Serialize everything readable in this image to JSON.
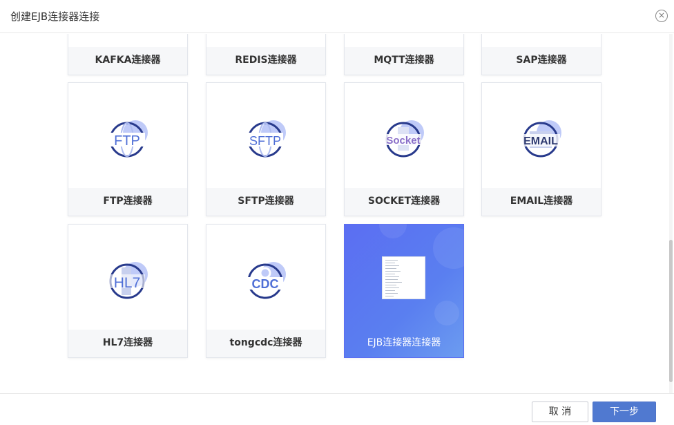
{
  "dialog": {
    "title": "创建EJB连接器连接",
    "close_icon": "close-circle-icon"
  },
  "connectors": [
    {
      "id": "kafka",
      "label": "KAFKA连接器",
      "logo_text": ""
    },
    {
      "id": "redis",
      "label": "REDIS连接器",
      "logo_text": ""
    },
    {
      "id": "mqtt",
      "label": "MQTT连接器",
      "logo_text": ""
    },
    {
      "id": "sap",
      "label": "SAP连接器",
      "logo_text": ""
    },
    {
      "id": "ftp",
      "label": "FTP连接器",
      "logo_text": "FTP"
    },
    {
      "id": "sftp",
      "label": "SFTP连接器",
      "logo_text": "SFTP"
    },
    {
      "id": "socket",
      "label": "SOCKET连接器",
      "logo_text": "Socket"
    },
    {
      "id": "email",
      "label": "EMAIL连接器",
      "logo_text": "EMAIL"
    },
    {
      "id": "hl7",
      "label": "HL7连接器",
      "logo_text": "HL7"
    },
    {
      "id": "tongcdc",
      "label": "tongcdc连接器",
      "logo_text": "CDC"
    },
    {
      "id": "ejb",
      "label": "EJB连接器连接器",
      "logo_text": "",
      "selected": true
    }
  ],
  "footer": {
    "cancel_label": "取 消",
    "next_label": "下一步"
  },
  "colors": {
    "accent": "#5079d0",
    "selected_card": "#5b6ef2",
    "logo_ring": "#283a8c",
    "logo_blob": "#a9b8f5"
  }
}
